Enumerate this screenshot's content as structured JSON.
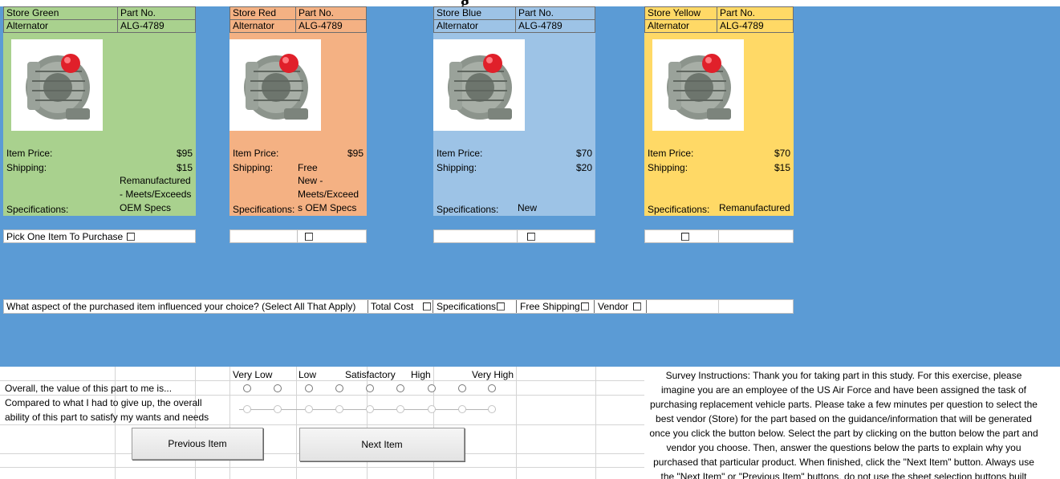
{
  "top_title_fragment": "g",
  "stores": [
    {
      "name": "Store Green",
      "part_label": "Part No.",
      "item": "Alternator",
      "part_no": "ALG-4789",
      "color": "#a9d18e",
      "price_label": "Item Price:",
      "price": "$95",
      "shipping_label": "Shipping:",
      "shipping": "$15",
      "spec_label": "Specifications:",
      "spec_lines": [
        "Remanufactured",
        "- Meets/Exceeds",
        "OEM Specs"
      ]
    },
    {
      "name": "Store Red",
      "part_label": "Part No.",
      "item": "Alternator",
      "part_no": "ALG-4789",
      "color": "#f4b183",
      "price_label": "Item Price:",
      "price": "$95",
      "shipping_label": "Shipping:",
      "shipping": "Free",
      "spec_label": "Specifications:",
      "spec_lines": [
        "New -",
        "Meets/Exceed",
        "s OEM Specs"
      ]
    },
    {
      "name": "Store Blue",
      "part_label": "Part No.",
      "item": "Alternator",
      "part_no": "ALG-4789",
      "color": "#9dc3e6",
      "price_label": "Item Price:",
      "price": "$70",
      "shipping_label": "Shipping:",
      "shipping": "$20",
      "spec_label": "Specifications:",
      "spec_lines": [
        "New"
      ]
    },
    {
      "name": "Store Yellow",
      "part_label": "Part No.",
      "item": "Alternator",
      "part_no": "ALG-4789",
      "color": "#ffd966",
      "price_label": "Item Price:",
      "price": "$70",
      "shipping_label": "Shipping:",
      "shipping": "$15",
      "spec_label": "Specifications:",
      "spec_lines": [
        "Remanufactured"
      ]
    }
  ],
  "pick_label": "Pick One Item To Purchase",
  "influence": {
    "question": "What aspect of the purchased item influenced your choice? (Select All That Apply)",
    "options": [
      "Total Cost",
      "Specifications",
      "Free Shipping",
      "Vendor"
    ]
  },
  "rating": {
    "scale": [
      "Very Low",
      "Low",
      "Satisfactory",
      "High",
      "Very High"
    ],
    "q1": "Overall, the value of this part to me is...",
    "q2_line1": "Compared to what I had to give up, the overall",
    "q2_line2": "ability of this part to satisfy my wants and needs"
  },
  "buttons": {
    "previous": "Previous Item",
    "next": "Next Item"
  },
  "instructions": "Survey Instructions: Thank you for taking part in this study. For this exercise, please imagine you are an employee of the US Air Force and have been assigned the task of purchasing replacement vehicle parts. Please take a few minutes per question to select the best vendor (Store) for the part based on the guidance/information that will be generated once you click the button below. Select the part by clicking on the button below the part and vendor you choose. Then, answer the questions below the parts to explain why you purchased that particular product. When finished, click the \"Next Item\" button. Always use the \"Next Item\" or \"Previous Item\" buttons, do not use the sheet selection buttons built"
}
